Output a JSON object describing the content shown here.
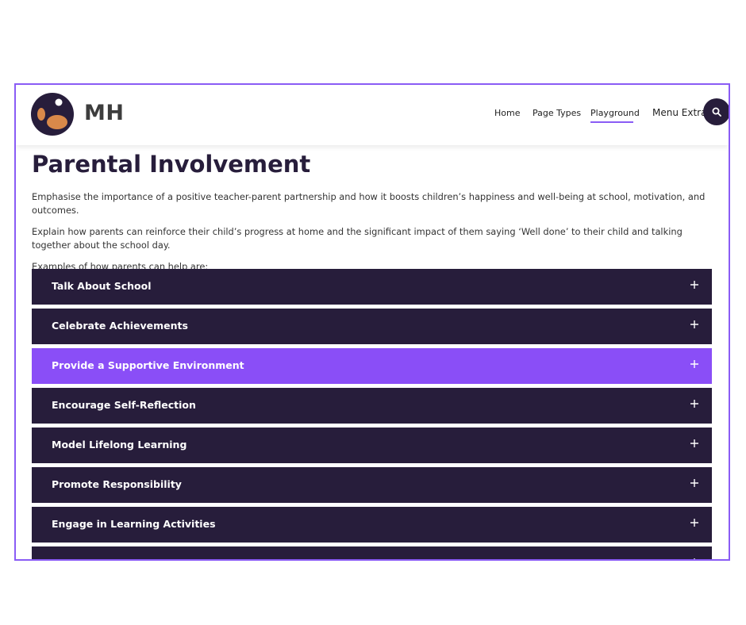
{
  "header": {
    "brand": "MH",
    "nav": [
      "Home",
      "Page Types",
      "Playground"
    ],
    "menu_extras": "Menu Extras",
    "active_nav": "Playground"
  },
  "page": {
    "title": "Parental Involvement",
    "paragraphs": [
      "Emphasise the importance of a positive teacher-parent partnership and how it boosts children’s happiness and well-being at school, motivation, and outcomes.",
      "Explain how parents can reinforce their child’s progress at home and the significant impact of them saying ‘Well done’ to their child and talking together about the school day.",
      "Examples of how parents can help are:"
    ]
  },
  "accordion": {
    "items": [
      {
        "label": "Talk About School"
      },
      {
        "label": "Celebrate Achievements"
      },
      {
        "label": "Provide a Supportive Environment"
      },
      {
        "label": "Encourage Self-Reflection"
      },
      {
        "label": "Model Lifelong Learning"
      },
      {
        "label": "Promote Responsibility"
      },
      {
        "label": "Engage in Learning Activities"
      },
      {
        "label": ""
      }
    ],
    "active_index": 2
  },
  "colors": {
    "dark": "#271d3b",
    "accent": "#8a4ef7",
    "frame": "#8a5cf5",
    "logo_orange": "#d9894a"
  },
  "icons": {
    "search": "search-icon",
    "expand": "plus-icon"
  }
}
